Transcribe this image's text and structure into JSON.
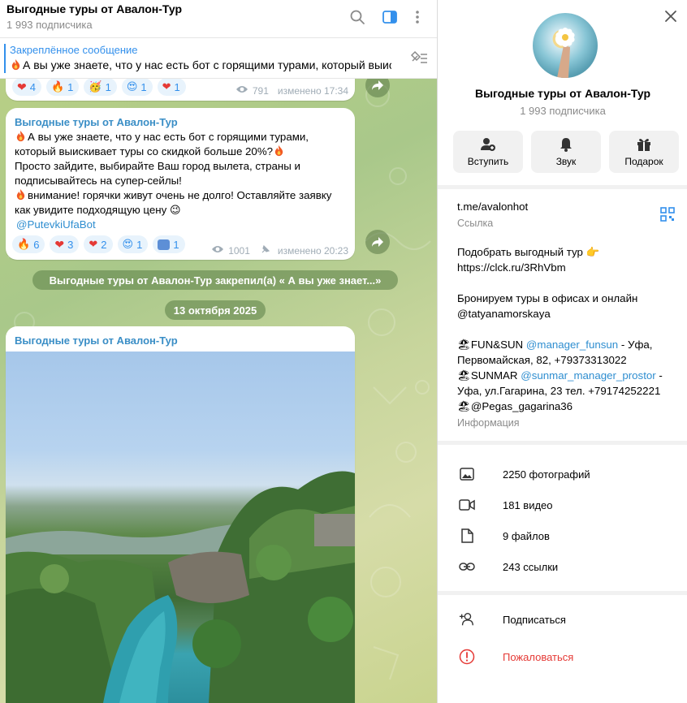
{
  "chat": {
    "title": "Выгодные туры от Авалон-Тур",
    "subtitle": "1 993 подписчика",
    "pinned": {
      "title": "Закреплённое сообщение",
      "text": "А вы уже знаете, что у нас есть бот с горящими турами, который выис..."
    },
    "msg1": {
      "reactions": [
        "4",
        "1",
        "1",
        "1",
        "1"
      ],
      "views": "791",
      "edited": "изменено 17:34"
    },
    "msg2": {
      "sender": "Выгодные туры от Авалон-Тур",
      "lines": [
        "А вы уже знаете, что у нас есть бот с горящими турами,",
        "который выискивает туры со скидкой больше 20%?",
        "Просто зайдите, выбирайте Ваш город вылета, страны и",
        "подписывайтесь на супер-сейлы!",
        "внимание! горячки живут очень не долго! Оставляйте заявку",
        "как увидите подходящую цену"
      ],
      "mention": "@PutevkiUfaBot",
      "reactions": [
        "6",
        "3",
        "2",
        "1",
        "1"
      ],
      "views": "1001",
      "edited": "изменено 20:23"
    },
    "service_pin": "Выгодные туры от Авалон-Тур закрепил(а) « А вы уже знает...»",
    "date": "13 октября 2025",
    "msg3": {
      "sender": "Выгодные туры от Авалон-Тур"
    }
  },
  "panel": {
    "title": "Выгодные туры от Авалон-Тур",
    "subtitle": "1 993 подписчика",
    "buttons": {
      "join": "Вступить",
      "sound": "Звук",
      "gift": "Подарок"
    },
    "link": "t.me/avalonhot",
    "link_label": "Ссылка",
    "info": {
      "line1": "Подобрать выгодный тур",
      "line2": "https://clck.ru/3RhVbm",
      "line3": "Бронируем туры в офисах и онлайн",
      "line4": "@tatyanamorskaya",
      "line5a": "FUN&SUN",
      "line5b": "@manager_funsun",
      "line5c": "- Уфа,",
      "line6": "Первомайская, 82, +79373313022",
      "line7a": "SUNMAR",
      "line7b": "@sunmar_manager_prostor",
      "line7c": "-",
      "line8": "Уфа, ул.Гагарина, 23 тел. +79174252221",
      "line9": "@Pegas_gagarina36",
      "label": "Информация"
    },
    "media": {
      "photos": "2250 фотографий",
      "videos": "181 видео",
      "files": "9 файлов",
      "links": "243 ссылки"
    },
    "actions": {
      "subscribe": "Подписаться",
      "report": "Пожаловаться"
    }
  },
  "colors": {
    "accent": "#3390ec",
    "danger": "#e53935"
  }
}
